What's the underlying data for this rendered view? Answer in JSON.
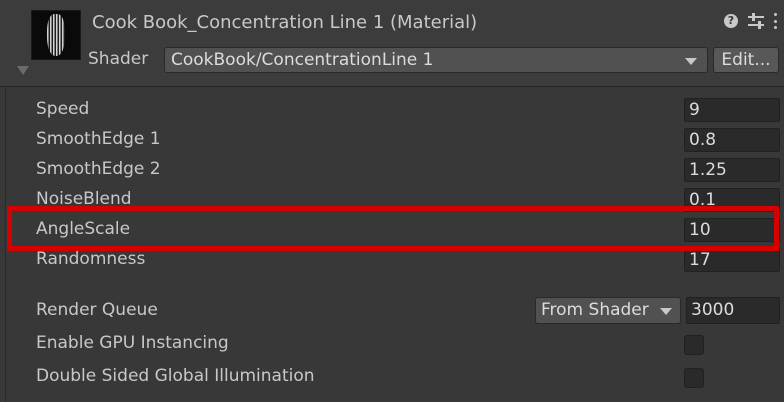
{
  "header": {
    "material_title": "Cook Book_Concentration Line 1 (Material)",
    "icons": [
      "help-icon",
      "sliders-icon",
      "more-icon"
    ],
    "shader_label": "Shader",
    "shader_value": "CookBook/ConcentrationLine 1",
    "edit_label": "Edit..."
  },
  "properties": [
    {
      "label": "Speed",
      "value": "9"
    },
    {
      "label": "SmoothEdge 1",
      "value": "0.8"
    },
    {
      "label": "SmoothEdge 2",
      "value": "1.25"
    },
    {
      "label": "NoiseBlend",
      "value": "0.1"
    },
    {
      "label": "AngleScale",
      "value": "10"
    },
    {
      "label": "Randomness",
      "value": "17"
    }
  ],
  "highlight": {
    "target": "AngleScale",
    "color": "#d50000"
  },
  "render_queue": {
    "label": "Render Queue",
    "mode": "From Shader",
    "value": "3000"
  },
  "toggles": [
    {
      "label": "Enable GPU Instancing",
      "checked": false
    },
    {
      "label": "Double Sided Global Illumination",
      "checked": false
    }
  ]
}
